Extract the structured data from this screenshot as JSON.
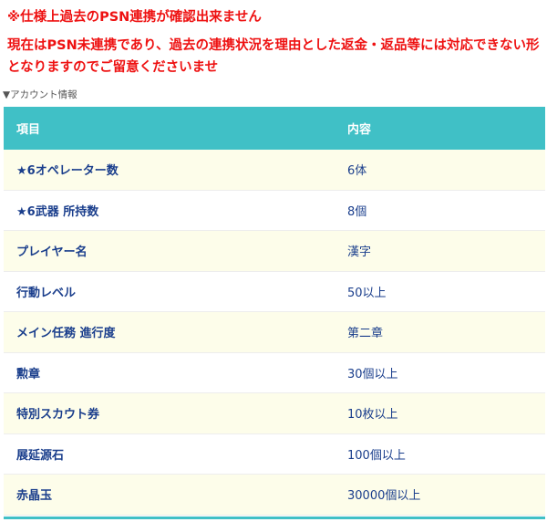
{
  "notice": {
    "title": "※仕様上過去のPSN連携が確認出来ません",
    "body": "現在はPSN未連携であり、過去の連携状況を理由とした返金・返品等には対応できない形となりますのでご留意くださいませ"
  },
  "section": {
    "label": "▼アカウント情報"
  },
  "table": {
    "headers": {
      "item": "項目",
      "value": "内容"
    },
    "rows": [
      {
        "item": "★6オペレーター数",
        "value": "6体"
      },
      {
        "item": "★6武器 所持数",
        "value": "8個"
      },
      {
        "item": "プレイヤー名",
        "value": "漢字"
      },
      {
        "item": "行動レベル",
        "value": "50以上"
      },
      {
        "item": "メイン任務 進行度",
        "value": "第二章"
      },
      {
        "item": "勲章",
        "value": "30個以上"
      },
      {
        "item": "特別スカウト券",
        "value": "10枚以上"
      },
      {
        "item": "展延源石",
        "value": "100個以上"
      },
      {
        "item": "赤晶玉",
        "value": "30000個以上"
      }
    ]
  },
  "colors": {
    "notice_red": "#ee1111",
    "header_teal": "#40c0c6",
    "row_stripe": "#fdfdea",
    "cell_text_navy": "#1a3e8c"
  }
}
